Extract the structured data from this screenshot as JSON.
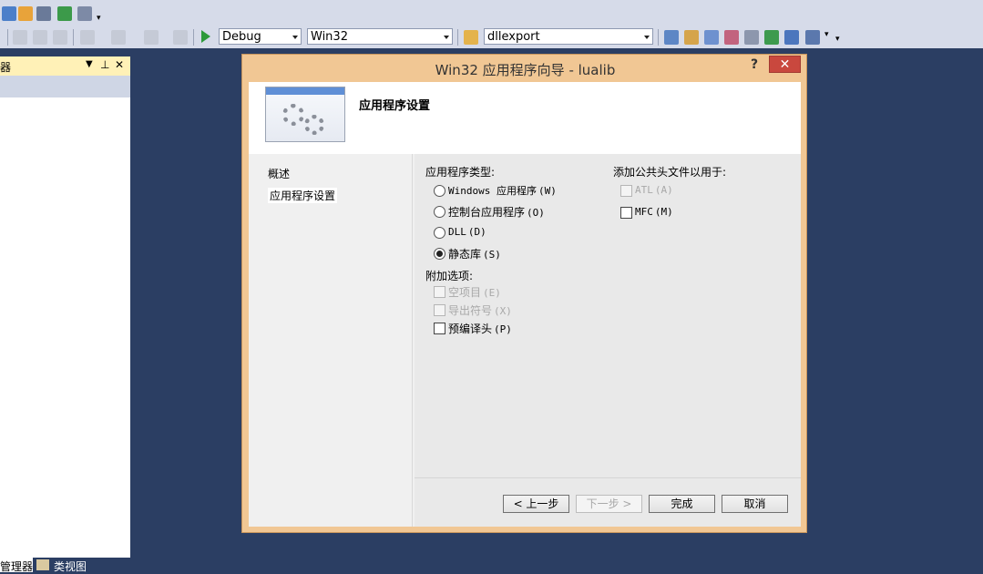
{
  "toolbar": {
    "config_combo": "Debug",
    "platform_combo": "Win32",
    "project_combo": "dllexport"
  },
  "left_panel": {
    "title": "器",
    "pin_glyph": "▾ ⊥",
    "close_glyph": "✕"
  },
  "bottom_tabs": {
    "solution_tab": "管理器",
    "class_view_tab": "类视图"
  },
  "dialog": {
    "title": "Win32 应用程序向导 - lualib",
    "help": "?",
    "close": "✕",
    "header_title": "应用程序设置",
    "nav": [
      "概述",
      "应用程序设置"
    ],
    "app_type_label": "应用程序类型:",
    "app_types": [
      {
        "text": "Windows 应用程序",
        "mnemonic": "(W)",
        "selected": false
      },
      {
        "text": "控制台应用程序",
        "mnemonic": "(O)",
        "selected": false
      },
      {
        "text": "DLL",
        "mnemonic": "(D)",
        "selected": false
      },
      {
        "text": "静态库",
        "mnemonic": "(S)",
        "selected": true
      }
    ],
    "extra_label": "附加选项:",
    "extras": [
      {
        "text": "空项目",
        "mnemonic": "(E)",
        "enabled": false,
        "checked": false
      },
      {
        "text": "导出符号",
        "mnemonic": "(X)",
        "enabled": false,
        "checked": false
      },
      {
        "text": "预编译头",
        "mnemonic": "(P)",
        "enabled": true,
        "checked": false
      }
    ],
    "headers_label": "添加公共头文件以用于:",
    "headers": [
      {
        "text": "ATL",
        "mnemonic": "(A)",
        "enabled": false,
        "checked": false
      },
      {
        "text": "MFC",
        "mnemonic": "(M)",
        "enabled": true,
        "checked": false
      }
    ],
    "buttons": {
      "prev": "< 上一步",
      "next": "下一步 >",
      "finish": "完成",
      "cancel": "取消"
    }
  }
}
